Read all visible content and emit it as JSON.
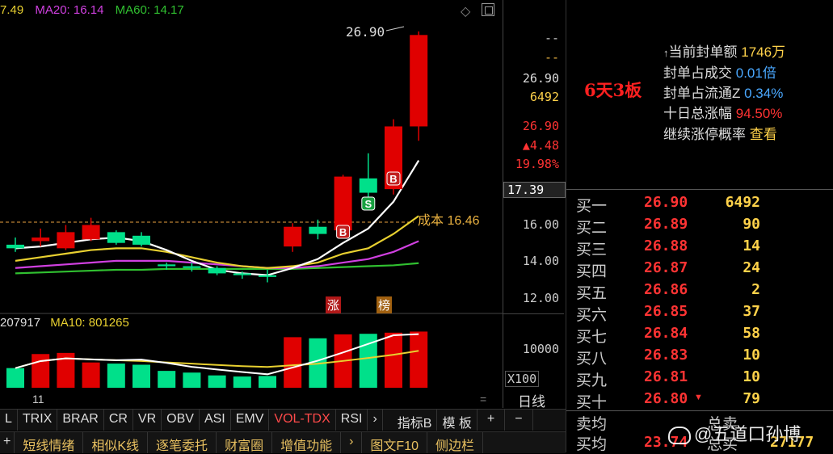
{
  "header": {
    "ma_prefix": "7.49",
    "ma20": "MA20: 16.14",
    "ma60": "MA60: 14.17"
  },
  "colors": {
    "up": "#e00000",
    "down": "#00e08a",
    "ma5": "#ffffff",
    "ma10": "#e8d030",
    "ma20": "#d040e0",
    "ma60": "#30c030"
  },
  "chart_data": {
    "type": "candlestick",
    "ylim": [
      11.5,
      27.5
    ],
    "candles": [
      {
        "o": 15.2,
        "h": 15.6,
        "l": 14.8,
        "c": 15.0
      },
      {
        "o": 15.4,
        "h": 16.1,
        "l": 15.1,
        "c": 15.6
      },
      {
        "o": 15.0,
        "h": 16.3,
        "l": 14.9,
        "c": 15.9
      },
      {
        "o": 15.5,
        "h": 16.7,
        "l": 15.4,
        "c": 16.3
      },
      {
        "o": 15.9,
        "h": 16.0,
        "l": 15.2,
        "c": 15.3
      },
      {
        "o": 15.7,
        "h": 15.9,
        "l": 15.1,
        "c": 15.2
      },
      {
        "o": 14.1,
        "h": 14.2,
        "l": 13.8,
        "c": 14.0
      },
      {
        "o": 14.0,
        "h": 14.2,
        "l": 13.7,
        "c": 13.9
      },
      {
        "o": 13.9,
        "h": 14.0,
        "l": 13.5,
        "c": 13.6
      },
      {
        "o": 13.6,
        "h": 13.7,
        "l": 13.3,
        "c": 13.5
      },
      {
        "o": 13.5,
        "h": 13.8,
        "l": 13.1,
        "c": 13.4
      },
      {
        "o": 15.1,
        "h": 16.4,
        "l": 14.8,
        "c": 16.2
      },
      {
        "o": 16.2,
        "h": 16.6,
        "l": 15.5,
        "c": 15.8
      },
      {
        "o": 16.0,
        "h": 19.1,
        "l": 15.9,
        "c": 19.0
      },
      {
        "o": 18.9,
        "h": 20.3,
        "l": 17.7,
        "c": 18.1
      },
      {
        "o": 18.3,
        "h": 22.2,
        "l": 18.0,
        "c": 21.8
      },
      {
        "o": 21.8,
        "h": 27.1,
        "l": 21.0,
        "c": 26.9
      }
    ],
    "ma_lines": {
      "ma5": [
        15.0,
        15.1,
        15.3,
        15.5,
        15.6,
        15.4,
        14.9,
        14.3,
        13.8,
        13.6,
        13.5,
        13.9,
        14.4,
        15.3,
        16.1,
        17.6,
        19.9
      ],
      "ma10": [
        14.3,
        14.5,
        14.7,
        14.9,
        15.0,
        15.0,
        14.8,
        14.5,
        14.2,
        14.0,
        13.9,
        14.0,
        14.2,
        14.7,
        15.0,
        15.8,
        16.8
      ],
      "ma20": [
        13.9,
        14.0,
        14.1,
        14.2,
        14.3,
        14.3,
        14.3,
        14.2,
        14.1,
        14.0,
        13.9,
        13.9,
        14.0,
        14.2,
        14.4,
        14.8,
        15.4
      ],
      "ma60": [
        13.6,
        13.65,
        13.7,
        13.75,
        13.8,
        13.8,
        13.85,
        13.85,
        13.85,
        13.85,
        13.85,
        13.85,
        13.9,
        13.95,
        14.0,
        14.05,
        14.17
      ]
    },
    "volume": {
      "header_value": "207917",
      "ma10_label": "MA10: 801265",
      "values": [
        350000,
        600000,
        620000,
        450000,
        430000,
        410000,
        300000,
        270000,
        220000,
        200000,
        210000,
        900000,
        880000,
        950000,
        960000,
        980000,
        1000000
      ],
      "ylim": [
        0,
        1150000
      ],
      "axis_tick": "10000",
      "axis_unit": "X100"
    },
    "marks": {
      "high_label": "26.90",
      "cost_label": "成本 16.46",
      "cost_value": 16.46,
      "zhang": "涨",
      "bang": "榜",
      "b": "B",
      "s": "S",
      "date_tick": "11"
    },
    "axis_labels": [
      "16.00",
      "14.00",
      "12.00"
    ],
    "axis_values": [
      16.0,
      14.0,
      12.0
    ]
  },
  "side_axis": {
    "dash1": "--",
    "dash2": "--",
    "price": "26.90",
    "vol": "6492",
    "price2": "26.90",
    "change": "▲4.48",
    "pct": "19.98%",
    "current": "17.39",
    "period": "日线",
    "dash3": "--"
  },
  "info_panel": {
    "streak": "6天3板",
    "rows": [
      {
        "k": "当前封单额",
        "v": "1746万",
        "c": "y",
        "prefix": "↑"
      },
      {
        "k": "封单占成交",
        "v": "0.01倍",
        "c": "b"
      },
      {
        "k": "封单占流通Z",
        "v": "0.34%",
        "c": "b"
      },
      {
        "k": "十日总涨幅",
        "v": "94.50%",
        "c": "r"
      },
      {
        "k": "继续涨停概率",
        "v": "查看",
        "c": "y"
      }
    ]
  },
  "orderbook": [
    {
      "label": "买一",
      "price": "26.90",
      "vol": "6492"
    },
    {
      "label": "买二",
      "price": "26.89",
      "vol": "90"
    },
    {
      "label": "买三",
      "price": "26.88",
      "vol": "14"
    },
    {
      "label": "买四",
      "price": "26.87",
      "vol": "24"
    },
    {
      "label": "买五",
      "price": "26.86",
      "vol": "2"
    },
    {
      "label": "买六",
      "price": "26.85",
      "vol": "37"
    },
    {
      "label": "买七",
      "price": "26.84",
      "vol": "58"
    },
    {
      "label": "买八",
      "price": "26.83",
      "vol": "10"
    },
    {
      "label": "买九",
      "price": "26.81",
      "vol": "10"
    },
    {
      "label": "买十",
      "price": "26.80",
      "vol": "79"
    }
  ],
  "orderbook_footer": {
    "sell_avg": "卖均",
    "buy_avg": "买均",
    "buy_avg_price": "23.74",
    "total": "总卖",
    "total2": "总买",
    "total_vol": "27177",
    "watermark": "@五道口孙博"
  },
  "tabs": [
    "L",
    "TRIX",
    "BRAR",
    "CR",
    "VR",
    "OBV",
    "ASI",
    "EMV",
    "VOL-TDX",
    "RSI",
    "›",
    "指标B",
    "模 板",
    "+",
    "−"
  ],
  "active_tab": "VOL-TDX",
  "bottom_buttons": [
    "+",
    "短线情绪",
    "相似K线",
    "逐笔委托",
    "财富圈",
    "增值功能",
    "›",
    "图文F10",
    "侧边栏"
  ]
}
